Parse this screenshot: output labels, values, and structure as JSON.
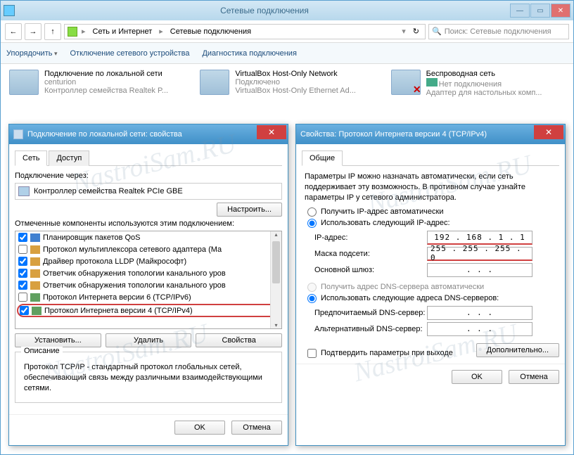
{
  "main": {
    "title": "Сетевые подключения",
    "breadcrumb": {
      "seg1": "Сеть и Интернет",
      "seg2": "Сетевые подключения"
    },
    "search_placeholder": "Поиск: Сетевые подключения",
    "toolbar": {
      "organize": "Упорядочить",
      "disable": "Отключение сетевого устройства",
      "diagnose": "Диагностика подключения"
    },
    "connections": [
      {
        "name": "Подключение по локальной сети",
        "status": "centurion",
        "device": "Контроллер семейства Realtek P..."
      },
      {
        "name": "VirtualBox Host-Only Network",
        "status": "Подключено",
        "device": "VirtualBox Host-Only Ethernet Ad..."
      },
      {
        "name": "Беспроводная сеть",
        "status": "Нет подключения",
        "device": "Адаптер для настольных комп..."
      }
    ]
  },
  "dlg_left": {
    "title": "Подключение по локальной сети: свойства",
    "tabs": {
      "net": "Сеть",
      "access": "Доступ"
    },
    "connect_via": "Подключение через:",
    "adapter": "Контроллер семейства Realtek PCIe GBE",
    "configure": "Настроить...",
    "components_label": "Отмеченные компоненты используются этим подключением:",
    "components": [
      {
        "label": "Планировщик пакетов QoS",
        "icon": "ci-sched",
        "checked": true
      },
      {
        "label": "Протокол мультиплексора сетевого адаптера (Ма",
        "icon": "ci-net",
        "checked": false
      },
      {
        "label": "Драйвер протокола LLDP (Майкрософт)",
        "icon": "ci-net",
        "checked": true
      },
      {
        "label": "Ответчик обнаружения топологии канального уров",
        "icon": "ci-net",
        "checked": true
      },
      {
        "label": "Ответчик обнаружения топологии канального уров",
        "icon": "ci-net",
        "checked": true
      },
      {
        "label": "Протокол Интернета версии 6 (TCP/IPv6)",
        "icon": "ci-proto",
        "checked": false
      },
      {
        "label": "Протокол Интернета версии 4 (TCP/IPv4)",
        "icon": "ci-proto",
        "checked": true,
        "hl": true
      }
    ],
    "install": "Установить...",
    "uninstall": "Удалить",
    "properties": "Свойства",
    "desc_title": "Описание",
    "desc_text": "Протокол TCP/IP - стандартный протокол глобальных сетей, обеспечивающий связь между различными взаимодействующими сетями.",
    "ok": "OK",
    "cancel": "Отмена"
  },
  "dlg_right": {
    "title": "Свойства: Протокол Интернета версии 4 (TCP/IPv4)",
    "tab_general": "Общие",
    "intro": "Параметры IP можно назначать автоматически, если сеть поддерживает эту возможность. В противном случае узнайте параметры IP у сетевого администратора.",
    "radio_auto_ip": "Получить IP-адрес автоматически",
    "radio_manual_ip": "Использовать следующий IP-адрес:",
    "ip_label": "IP-адрес:",
    "ip_value": "192 . 168 .  1  .  1",
    "mask_label": "Маска подсети:",
    "mask_value": "255 . 255 . 255 .  0",
    "gateway_label": "Основной шлюз:",
    "gateway_value": " .       .       . ",
    "radio_auto_dns": "Получить адрес DNS-сервера автоматически",
    "radio_manual_dns": "Использовать следующие адреса DNS-серверов:",
    "dns1_label": "Предпочитаемый DNS-сервер:",
    "dns1_value": " .       .       . ",
    "dns2_label": "Альтернативный DNS-сервер:",
    "dns2_value": " .       .       . ",
    "confirm_exit": "Подтвердить параметры при выходе",
    "advanced": "Дополнительно...",
    "ok": "OK",
    "cancel": "Отмена"
  }
}
